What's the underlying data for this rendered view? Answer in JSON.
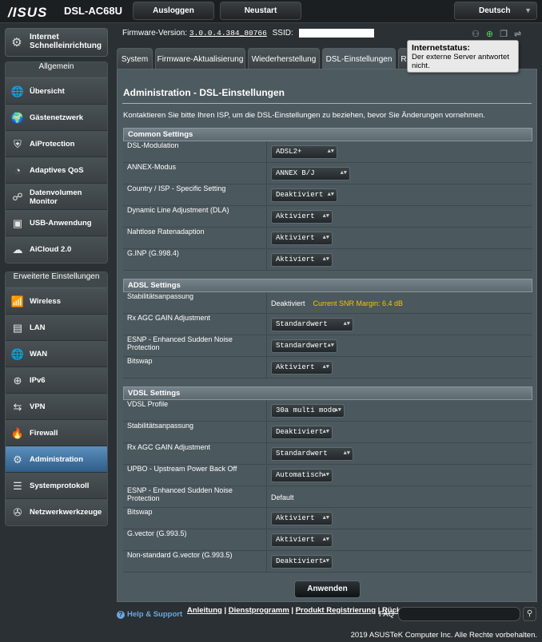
{
  "header": {
    "logo": "/ISUS",
    "model": "DSL-AC68U",
    "logout_label": "Ausloggen",
    "reboot_label": "Neustart",
    "language": "Deutsch"
  },
  "firmware": {
    "label": "Firmware-Version:",
    "version": "3.0.0.4.384_80766",
    "ssid_label": "SSID:"
  },
  "tooltip": {
    "title": "Internetstatus:",
    "text": "Der externe Server antwortet nicht."
  },
  "sidebar": {
    "quick_setup": "Internet Schnelleinrichtung",
    "general_head": "Allgemein",
    "general_items": [
      {
        "label": "Übersicht",
        "icon": "network-map-icon"
      },
      {
        "label": "Gästenetzwerk",
        "icon": "guest-network-icon"
      },
      {
        "label": "AiProtection",
        "icon": "shield-icon"
      },
      {
        "label": "Adaptives QoS",
        "icon": "qos-gauge-icon"
      },
      {
        "label": "Datenvolumen Monitor",
        "icon": "traffic-monitor-icon"
      },
      {
        "label": "USB-Anwendung",
        "icon": "usb-icon"
      },
      {
        "label": "AiCloud 2.0",
        "icon": "cloud-icon"
      }
    ],
    "advanced_head": "Erweiterte Einstellungen",
    "advanced_items": [
      {
        "label": "Wireless",
        "icon": "wifi-icon"
      },
      {
        "label": "LAN",
        "icon": "lan-icon"
      },
      {
        "label": "WAN",
        "icon": "globe-icon"
      },
      {
        "label": "IPv6",
        "icon": "ipv6-icon"
      },
      {
        "label": "VPN",
        "icon": "vpn-icon"
      },
      {
        "label": "Firewall",
        "icon": "fire-icon"
      },
      {
        "label": "Administration",
        "icon": "admin-gear-icon"
      },
      {
        "label": "Systemprotokoll",
        "icon": "log-icon"
      },
      {
        "label": "Netzwerkwerkzeuge",
        "icon": "tools-icon"
      }
    ],
    "active": "Administration"
  },
  "tabs": [
    "System",
    "Firmware-Aktualisierung",
    "Wiederherstellung",
    "DSL-Einstellungen",
    "R"
  ],
  "active_tab": "DSL-Einstellungen",
  "page": {
    "title": "Administration - DSL-Einstellungen",
    "intro": "Kontaktieren Sie bitte Ihren ISP, um die DSL-Einstellungen zu beziehen, bevor Sie Änderungen vornehmen."
  },
  "common": {
    "head": "Common Settings",
    "rows": [
      {
        "label": "DSL-Modulation",
        "value": "ADSL2+"
      },
      {
        "label": "ANNEX-Modus",
        "value": "ANNEX B/J"
      },
      {
        "label": "Country / ISP - Specific Setting",
        "value": "Deaktiviert"
      },
      {
        "label": "Dynamic Line Adjustment (DLA)",
        "value": "Aktiviert"
      },
      {
        "label": "Nahtlose Ratenadaption",
        "value": "Aktiviert"
      },
      {
        "label": "G.INP (G.998.4)",
        "value": "Aktiviert"
      }
    ]
  },
  "adsl": {
    "head": "ADSL Settings",
    "stab_label": "Stabilitätsanpassung",
    "stab_value": "Deaktiviert",
    "snr_text": "Current SNR Margin: 6.4 dB",
    "rows": [
      {
        "label": "Rx AGC GAIN Adjustment",
        "value": "Standardwert"
      },
      {
        "label": "ESNP - Enhanced Sudden Noise Protection",
        "value": "Standardwert"
      },
      {
        "label": "Bitswap",
        "value": "Aktiviert"
      }
    ]
  },
  "vdsl": {
    "head": "VDSL Settings",
    "rows": [
      {
        "label": "VDSL Profile",
        "value": "30a multi mode"
      },
      {
        "label": "Stabilitätsanpassung",
        "value": "Deaktiviert"
      },
      {
        "label": "Rx AGC GAIN Adjustment",
        "value": "Standardwert"
      },
      {
        "label": "UPBO - Upstream Power Back Off",
        "value": "Automatisch"
      }
    ],
    "esnp_label": "ESNP - Enhanced Sudden Noise Protection",
    "esnp_value": "Default",
    "rows2": [
      {
        "label": "Bitswap",
        "value": "Aktiviert"
      },
      {
        "label": "G.vector (G.993.5)",
        "value": "Aktiviert"
      },
      {
        "label": "Non-standard G.vector (G.993.5)",
        "value": "Deaktiviert"
      }
    ]
  },
  "apply_label": "Anwenden",
  "footer": {
    "help": "Help & Support",
    "link1": "Anleitung",
    "link2": "Dienstprogramm",
    "link3": "Produkt Registrierung",
    "link4": "Rückmeldung",
    "faq": "FAQ",
    "copyright": "2019 ASUSTeK Computer Inc. Alle Rechte vorbehalten."
  },
  "colors": {
    "accent_active": "#3f73a3",
    "snr_text": "#f4c400",
    "link_blue": "#6aa8e0"
  }
}
